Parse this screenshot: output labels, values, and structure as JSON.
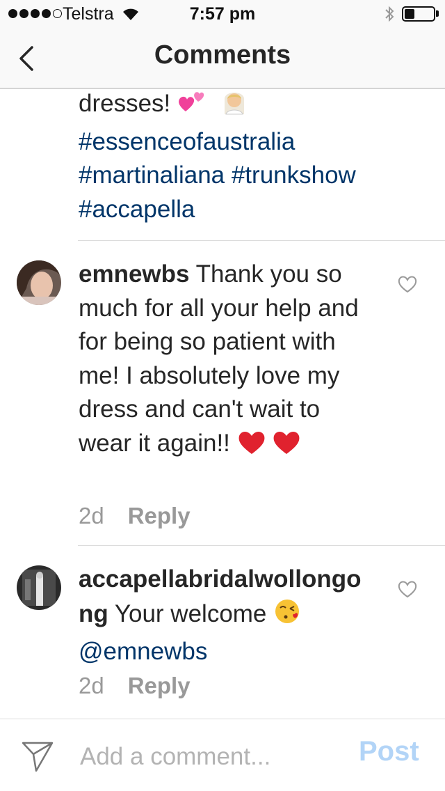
{
  "status_bar": {
    "carrier": "Telstra",
    "time": "7:57 pm",
    "signal_bars_filled": 4,
    "signal_bars_total": 5,
    "battery_level": 0.35
  },
  "nav": {
    "title": "Comments",
    "back_icon": "chevron-left-icon"
  },
  "caption": {
    "text_tail": "dresses!",
    "emojis": [
      "two-hearts",
      "bride-with-veil"
    ],
    "hashtags": [
      "#essenceofaustralia",
      "#martinaliana #trunkshow",
      "#accapella"
    ]
  },
  "comments": [
    {
      "username": "emnewbs",
      "text": " Thank you so much for all your help and for being so patient with me! I absolutely love my dress and can't wait to wear it again!! ",
      "emojis": [
        "red-heart",
        "red-heart"
      ],
      "age": "2d",
      "reply_label": "Reply"
    },
    {
      "username": "accapellabridalwollongong",
      "text": " Your welcome ",
      "emojis": [
        "face-blowing-kiss"
      ],
      "mention": "@emnewbs",
      "age": "2d",
      "reply_label": "Reply"
    }
  ],
  "footer": {
    "placeholder": "Add a comment...",
    "post_label": "Post",
    "send_icon": "paper-plane-icon"
  },
  "colors": {
    "link": "#003569",
    "muted": "#999999",
    "post_disabled": "#b2d4f7",
    "bar_bg": "#f9f9f9"
  }
}
